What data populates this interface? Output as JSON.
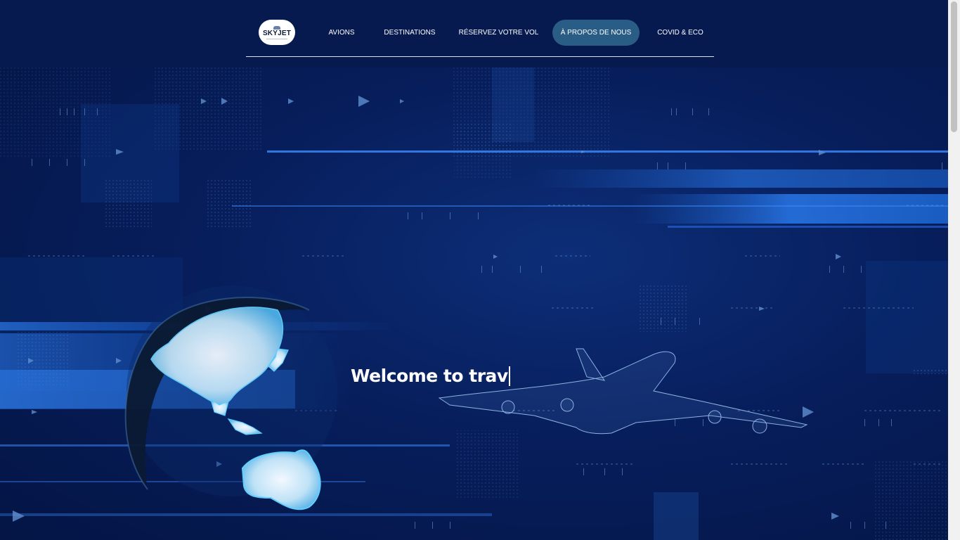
{
  "logo": {
    "text": "SKYJET"
  },
  "nav": {
    "items": [
      {
        "label": "AVIONS"
      },
      {
        "label": "DESTINATIONS"
      },
      {
        "label": "RÉSERVEZ VOTRE VOL"
      },
      {
        "label": "À PROPOS DE NOUS",
        "active": true
      },
      {
        "label": "COVID & ECO"
      }
    ]
  },
  "hero": {
    "headline": "Welcome to trav"
  },
  "colors": {
    "background": "#061a4f",
    "nav_active": "#2a5d86",
    "light_streak": "#1f6fe0",
    "globe_glow": "#9fd6f4"
  }
}
